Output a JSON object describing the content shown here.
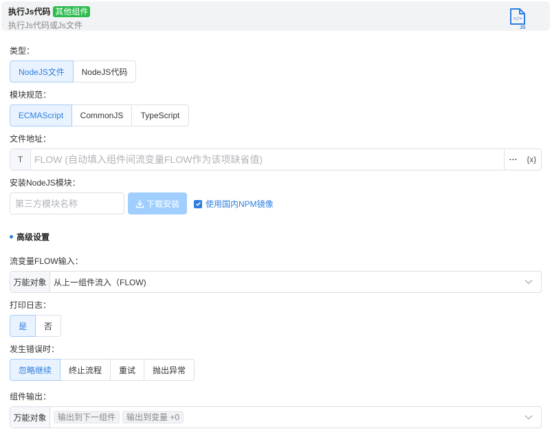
{
  "header": {
    "title": "执行Js代码",
    "tag": "其他组件",
    "subtitle": "执行Js代码或Js文件",
    "icon": "js-file-icon",
    "icon_text": "JS",
    "icon_glyph": "</>"
  },
  "type": {
    "label": "类型：",
    "options": [
      "NodeJS文件",
      "NodeJS代码"
    ],
    "selected": "NodeJS文件"
  },
  "module_spec": {
    "label": "模块规范：",
    "options": [
      "ECMAScript",
      "CommonJS",
      "TypeScript"
    ],
    "selected": "ECMAScript"
  },
  "file_path": {
    "label": "文件地址：",
    "prefix": "T",
    "placeholder": "FLOW (自动填入组件间流变量FLOW作为该项缺省值)",
    "value": "",
    "more_label": "···",
    "var_label": "{x}"
  },
  "install": {
    "label": "安装NodeJS模块：",
    "placeholder": "第三方模块名称",
    "button_label": "下载安装",
    "mirror_label": "使用国内NPM镜像",
    "mirror_checked": true
  },
  "advanced": {
    "title": "高级设置"
  },
  "flow_input": {
    "label": "流变量FLOW输入：",
    "prefix": "万能对象",
    "value": "从上一组件流入（FLOW)"
  },
  "print_log": {
    "label": "打印日志：",
    "options": [
      "是",
      "否"
    ],
    "selected": "是"
  },
  "on_error": {
    "label": "发生错误时：",
    "options": [
      "忽略继续",
      "终止流程",
      "重试",
      "抛出异常"
    ],
    "selected": "忽略继续"
  },
  "output": {
    "label": "组件输出：",
    "prefix": "万能对象",
    "chips": [
      "输出到下一组件",
      "输出到变量 +0"
    ]
  },
  "colors": {
    "accent": "#2d7de0",
    "tag": "#2dbb4e",
    "active_bg": "#e8f3ff",
    "button_disabled": "#a0cfff"
  }
}
